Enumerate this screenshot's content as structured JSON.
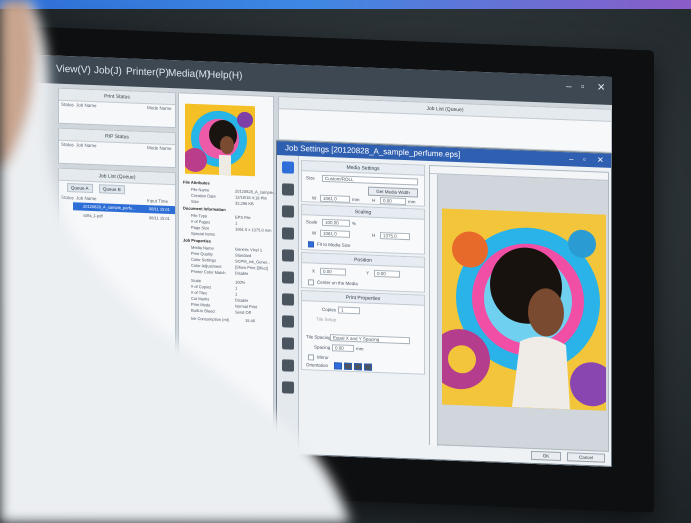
{
  "menu": [
    "View(V)",
    "Job(J)",
    "Printer(P)",
    "Media(M)",
    "Help(H)"
  ],
  "window_controls": [
    "–",
    "▫",
    "✕"
  ],
  "print_status": {
    "title": "Print Status",
    "columns": [
      "Status",
      "Job Name",
      "Mode Name"
    ]
  },
  "rip_status": {
    "title": "RIP Status",
    "columns": [
      "Status",
      "Job Name",
      "Mode Name"
    ]
  },
  "job_list": {
    "title": "Job List (Queue)",
    "tabs": [
      "Queue A",
      "Queue B"
    ],
    "columns": [
      "Status",
      "Job Name",
      "Input Time"
    ],
    "rows": [
      {
        "name": "20120828_A_sample_perfu...",
        "time": "08/11 15:01",
        "selected": true
      },
      {
        "name": "sofia_1.pdf",
        "time": "08/11 15:01",
        "selected": false
      }
    ]
  },
  "properties": {
    "sections": [
      {
        "title": "File Attributes",
        "items": [
          [
            "File Name",
            "20120828_A_sample..."
          ],
          [
            "Creation Date",
            "12/18/18 4:18 PM"
          ],
          [
            "Size",
            "33,296 KB"
          ]
        ]
      },
      {
        "title": "Document Information",
        "items": [
          [
            "File Type",
            "EPS File"
          ],
          [
            "# of Pages",
            "1"
          ],
          [
            "Page Size",
            "1061.0 x 1375.0 mm"
          ],
          [
            "Special Items",
            ""
          ]
        ]
      },
      {
        "title": "Job Properties",
        "items": [
          [
            "Media Name",
            "Generic Vinyl 1"
          ],
          [
            "Print Quality",
            "Standard"
          ],
          [
            "Color Settings",
            "SCPM_ink_Gener..."
          ],
          [
            "Color Adjustment",
            "[Show Print Effect]"
          ],
          [
            "Printer Color Match",
            "Disable"
          ],
          [
            "Scale",
            "100%"
          ],
          [
            "# of Copies",
            "1"
          ],
          [
            "# of Tiles",
            "1"
          ],
          [
            "Cut Marks",
            "Disable"
          ],
          [
            "Print Mode",
            "Normal Print"
          ],
          [
            "Built-in Bleed",
            "Send Off"
          ],
          [
            "Ink Consumption (ml)",
            "15.46"
          ]
        ]
      }
    ]
  },
  "right_pane": {
    "title": "Job List (Queue)"
  },
  "dialog": {
    "title": "Job Settings [20120828_A_sample_perfume.eps]",
    "media_settings": {
      "title": "Media Settings",
      "size_label": "Size",
      "size_value": "Custom/ROLL",
      "get_width_button": "Get Media Width",
      "w_label": "W",
      "w_value": "1061.0",
      "h_label": "H",
      "h_value": "0.00",
      "unit": "mm"
    },
    "scaling": {
      "title": "Scaling",
      "scale_label": "Scale",
      "scale_value": "100.00",
      "pct": "%",
      "w_value": "1061.0",
      "h_value": "1375.0",
      "fit_label": "Fit to Media Size"
    },
    "position": {
      "title": "Position",
      "x_label": "X",
      "x_value": "0.00",
      "y_label": "Y",
      "y_value": "0.00",
      "center_label": "Center on the Media"
    },
    "print_properties": {
      "title": "Print Properties",
      "copies_label": "Copies",
      "copies_value": "1",
      "tile_label": "Tile Setup",
      "spacing_type_label": "Tile Spacing",
      "spacing_type_value": "Equal X and Y Spacing",
      "spacing_label": "Spacing",
      "spacing_value": "0.00",
      "mirror_label": "Mirror",
      "orientation_label": "Orientation"
    },
    "ok_button": "OK",
    "cancel_button": "Cancel"
  },
  "colors": {
    "accent": "#2f6ed9",
    "menubar": "#3d4852",
    "dialog_title": "#2f5fb0",
    "gradient_bar_start": "#2f6fd6",
    "gradient_bar_end": "#8b5cc8"
  }
}
